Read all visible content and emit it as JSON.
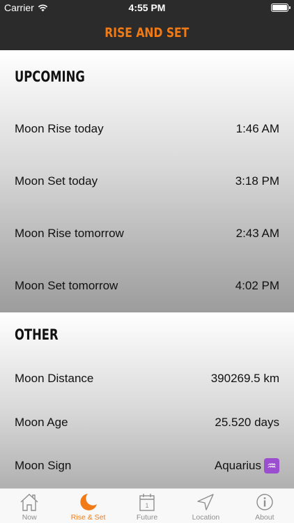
{
  "status_bar": {
    "carrier": "Carrier",
    "time": "4:55 PM"
  },
  "nav": {
    "title": "RISE AND SET"
  },
  "upcoming": {
    "title": "UPCOMING",
    "rows": [
      {
        "label": "Moon Rise today",
        "value": "1:46 AM"
      },
      {
        "label": "Moon Set today",
        "value": "3:18 PM"
      },
      {
        "label": "Moon Rise tomorrow",
        "value": "2:43 AM"
      },
      {
        "label": "Moon Set tomorrow",
        "value": "4:02 PM"
      }
    ]
  },
  "other": {
    "title": "OTHER",
    "rows": [
      {
        "label": "Moon Distance",
        "value": "390269.5 km"
      },
      {
        "label": "Moon Age",
        "value": "25.520 days"
      },
      {
        "label": "Moon Sign",
        "value": "Aquarius",
        "icon": "aquarius-icon"
      }
    ]
  },
  "tabs": [
    {
      "label": "Now",
      "icon": "house-icon",
      "active": false
    },
    {
      "label": "Rise & Set",
      "icon": "crescent-moon-icon",
      "active": true
    },
    {
      "label": "Future",
      "icon": "calendar-icon",
      "active": false
    },
    {
      "label": "Location",
      "icon": "location-arrow-icon",
      "active": false
    },
    {
      "label": "About",
      "icon": "info-icon",
      "active": false
    }
  ],
  "colors": {
    "accent": "#f07b16",
    "nav_background": "#2b2b2b",
    "tab_inactive": "#8e8e8e",
    "aquarius_badge": "#9b4fd0"
  },
  "calendar_day": "1"
}
